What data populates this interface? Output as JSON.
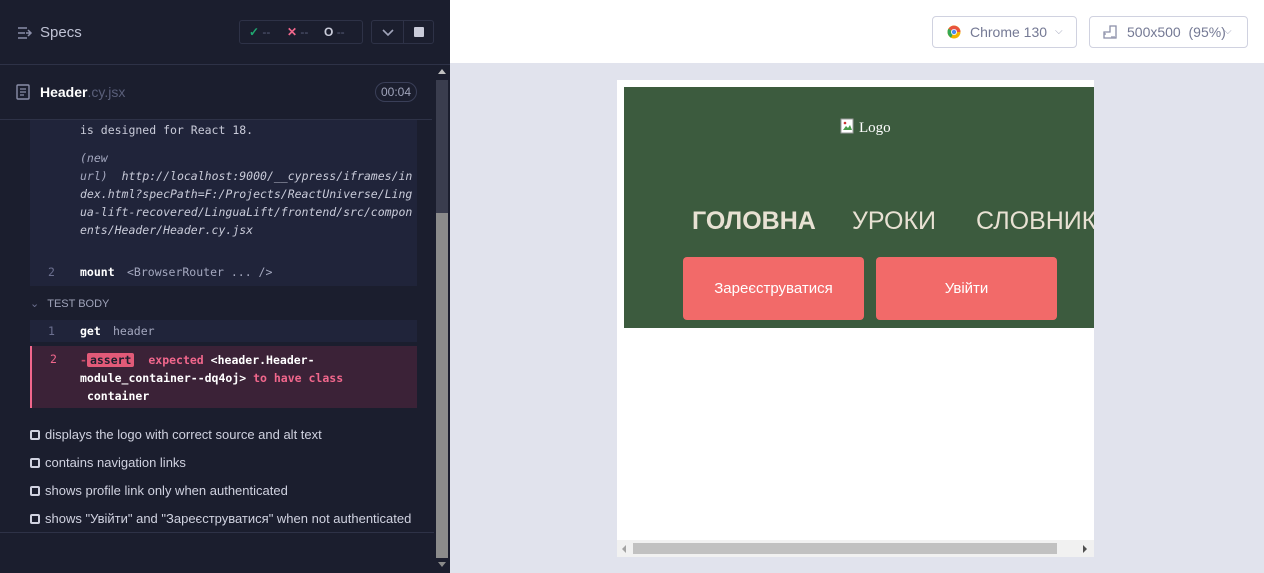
{
  "sidebar": {
    "title": "Specs",
    "icon": "hamburger-arrow-icon",
    "stats": {
      "passed": "--",
      "failed": "--",
      "pending": "--"
    }
  },
  "spec": {
    "name": "Header",
    "ext": ".cy.jsx",
    "duration": "00:04"
  },
  "command_log": {
    "mount_note": "is designed for React 18.",
    "url_label_1": "(new",
    "url_label_2": "url)",
    "url_value": "http://localhost:9000/__cypress/iframes/index.html?specPath=F:/Projects/ReactUniverse/Lingua-lift-recovered/LinguaLift/frontend/src/components/Header/Header.cy.jsx",
    "mount_row": {
      "number": "2",
      "command": "mount",
      "message": "<BrowserRouter ... />"
    },
    "test_body_label": "TEST BODY",
    "get_row": {
      "number": "1",
      "command": "get",
      "message": "header"
    },
    "assert_row": {
      "number": "2",
      "dash": "-",
      "command": "assert",
      "expected": "expected",
      "subject": "<header.Header-module_container--dq4oj>",
      "to_have_class": "to have class",
      "class_name": "container"
    }
  },
  "tests": [
    "displays the logo with correct source and alt text",
    "contains navigation links",
    "shows profile link only when authenticated",
    "shows \"Увійти\" and \"Зареєструватися\" when not authenticated"
  ],
  "toolbar": {
    "browser": "Chrome 130",
    "viewport": "500x500",
    "zoom": "(95%)"
  },
  "app": {
    "logo_alt": "Logo",
    "nav": [
      "ГОЛОВНА",
      "УРОКИ",
      "СЛОВНИК"
    ],
    "register_button": "Зареєструватися",
    "login_button": "Увійти"
  },
  "colors": {
    "sidebar_bg": "#1b1e2e",
    "header_green": "#3c5b3e",
    "cta_coral": "#f26a69",
    "fail_pink": "#f1678c",
    "pass_green": "#1fa971"
  }
}
